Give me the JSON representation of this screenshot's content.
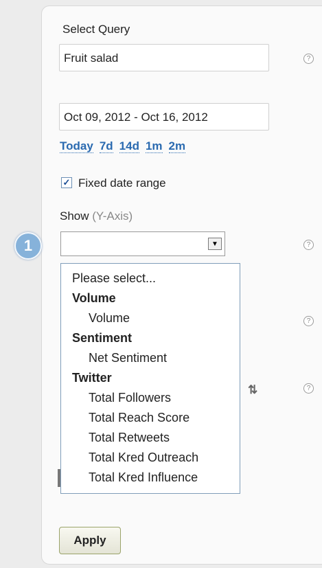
{
  "query": {
    "label": "Select Query",
    "value": "Fruit salad",
    "help": "?"
  },
  "date_range": {
    "value": "Oct 09, 2012 - Oct 16, 2012",
    "quick_links": [
      "Today",
      "7d",
      "14d",
      "1m",
      "2m"
    ]
  },
  "fixed_range": {
    "label": "Fixed date range",
    "checked": true,
    "check_glyph": "✓"
  },
  "y_axis": {
    "label_main": "Show",
    "label_hint": "(Y-Axis)",
    "value": "",
    "arrow_glyph": "▼",
    "help": "?",
    "step_badge": "1",
    "options": [
      {
        "type": "option",
        "label": "Please select..."
      },
      {
        "type": "group",
        "label": "Volume"
      },
      {
        "type": "option",
        "label": "Volume"
      },
      {
        "type": "group",
        "label": "Sentiment"
      },
      {
        "type": "option",
        "label": "Net Sentiment"
      },
      {
        "type": "group",
        "label": "Twitter"
      },
      {
        "type": "option",
        "label": "Total Followers"
      },
      {
        "type": "option",
        "label": "Total Reach Score"
      },
      {
        "type": "option",
        "label": "Total Retweets"
      },
      {
        "type": "option",
        "label": "Total Kred Outreach"
      },
      {
        "type": "option",
        "label": "Total Kred Influence"
      }
    ]
  },
  "extra_help": [
    "?",
    "?"
  ],
  "retweet_icon": "⇅",
  "apply": {
    "label": "Apply"
  }
}
